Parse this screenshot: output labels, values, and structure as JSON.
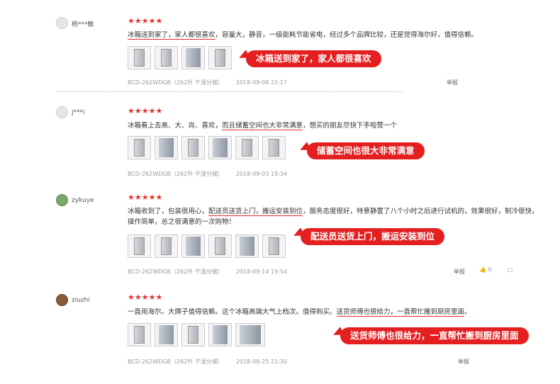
{
  "reviews": [
    {
      "user": "杨***敏",
      "stars": "★★★★★",
      "text_pre": "",
      "text_highlight": "冰箱送到家了，家人都很喜欢",
      "text_post": "，容量大，静音，一级能耗节能省电，经过多个品牌比较，还是觉得海尔好，值得信赖。",
      "spec": "BCD-262WDGB（262升 干湿分储）",
      "date": "2018-09-08 22:17",
      "report": "举报",
      "callout": "冰箱送到家了，家人都很喜欢"
    },
    {
      "user": "j***i",
      "stars": "★★★★★",
      "text_pre": "冰箱看上去高、大、尚、喜欢，",
      "text_highlight": "而且储蓄空间也大非常满意",
      "text_post": "，想买的朋友尽快下手啦赞一个",
      "spec": "BCD-262WDGB（262升 干湿分储）",
      "date": "2018-09-03 19:34",
      "callout": "储蓄空间也很大非常满意"
    },
    {
      "user": "zykuye",
      "stars": "★★★★★",
      "text_pre": "冰箱收到了，包装很用心，",
      "text_highlight": "配送员送货上门，搬运安装到位",
      "text_post": "，服务态度很好，特意静置了八个小时之后进行试机的，效果很好，制冷很快，操作简单，总之很满意的一次购物！",
      "spec": "BCD-262WDGB（262升 干湿分储）",
      "date": "2018-09-14 19:54",
      "report": "举报",
      "like_count": "0",
      "callout": "配送员送货上门，搬运安装到位"
    },
    {
      "user": "ziuzhi",
      "stars": "★★★★★",
      "text_pre": "一直用海尔。大牌子值得信赖。这个冰箱高端大气上档次。值得购买。",
      "text_highlight": "送货师傅也很给力，一直帮忙搬到厨房里面",
      "text_post": "。",
      "spec": "BCD-262WDGB（262升 干湿分储）",
      "date": "2018-08-25 21:30",
      "report": "举报",
      "callout": "送货师傅也很给力，一直帮忙搬到厨房里面"
    }
  ],
  "colors": {
    "accent": "#e41f1f",
    "star": "#e8312c"
  }
}
